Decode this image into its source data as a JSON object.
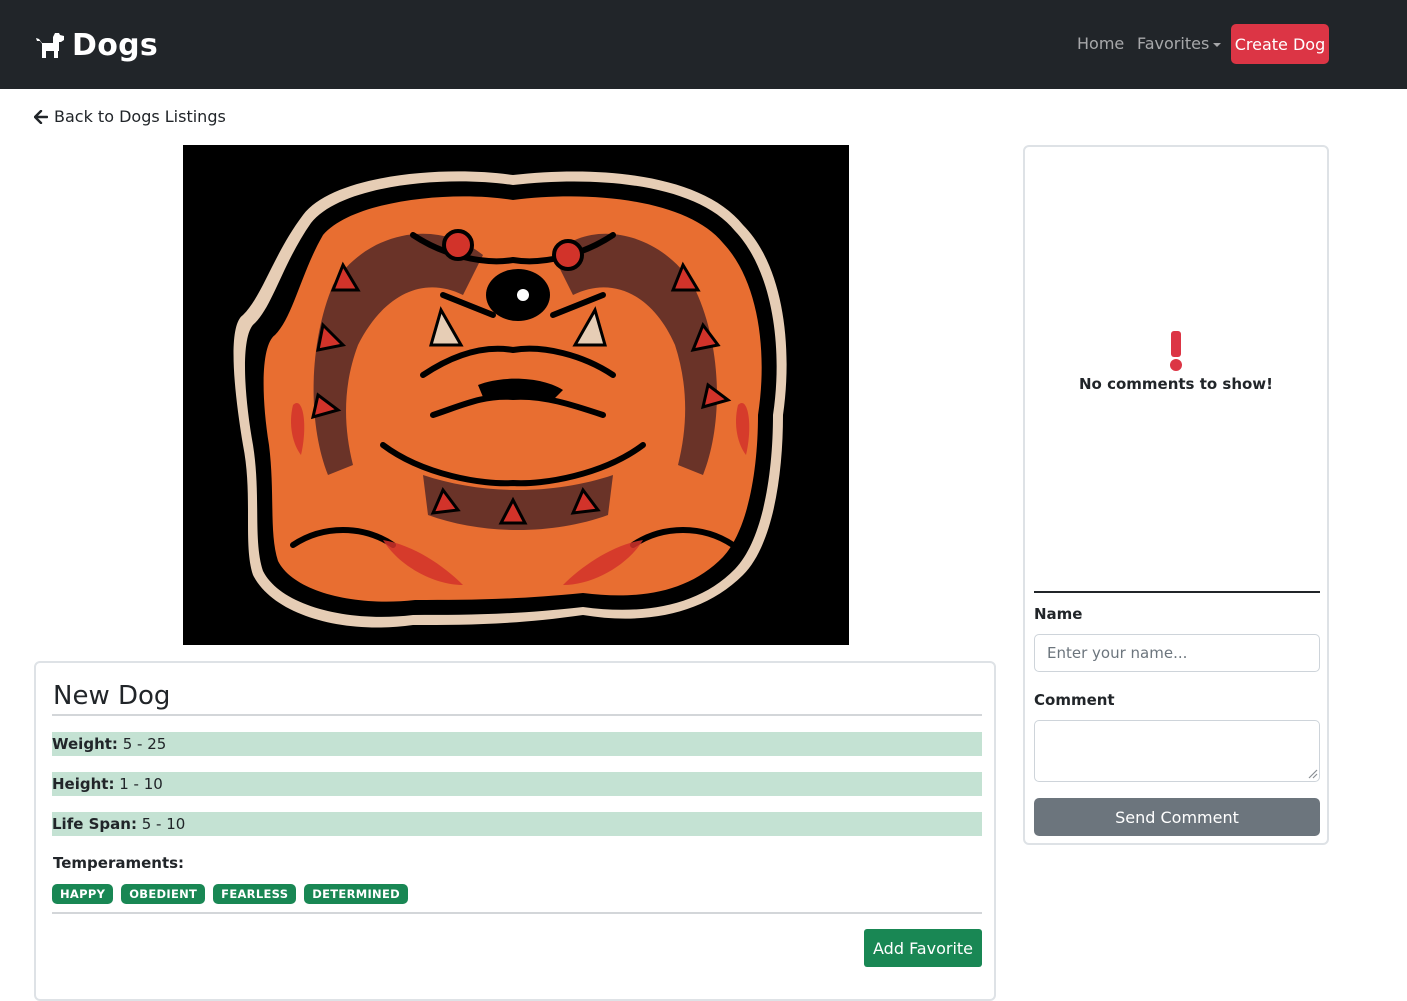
{
  "navbar": {
    "brand": "Dogs",
    "brand_icon": "dog-icon",
    "links": {
      "home": "Home",
      "favorites": "Favorites"
    },
    "create_button": "Create Dog",
    "colors": {
      "background": "#212529",
      "create_button": "#dc3545"
    }
  },
  "back_link": {
    "label": "Back to Dogs Listings",
    "icon": "arrow-left-icon"
  },
  "dog": {
    "name": "New Dog",
    "stats": [
      {
        "label": "Weight:",
        "value": "5 - 25"
      },
      {
        "label": "Height:",
        "value": "1 - 10"
      },
      {
        "label": "Life Span:",
        "value": "5 - 10"
      }
    ],
    "temperaments_label": "Temperaments:",
    "temperaments": [
      "HAPPY",
      "OBEDIENT",
      "FEARLESS",
      "DETERMINED"
    ],
    "add_favorite": "Add Favorite",
    "colors": {
      "stat_bg": "#c4e2d3",
      "badge": "#198754"
    }
  },
  "comments": {
    "empty_icon": "exclamation-icon",
    "empty_text": "No comments to show!",
    "name_label": "Name",
    "name_placeholder": "Enter your name...",
    "comment_label": "Comment",
    "send_button": "Send Comment"
  }
}
